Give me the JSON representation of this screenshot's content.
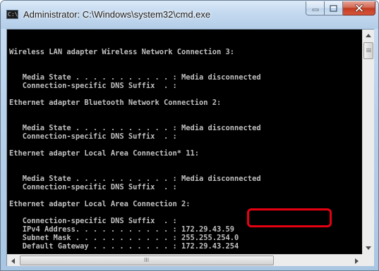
{
  "window": {
    "title": "Administrator: C:\\Windows\\system32\\cmd.exe",
    "app_icon_text": "C:\\"
  },
  "caption_buttons": {
    "minimize_icon": "minimize-icon",
    "maximize_icon": "maximize-icon",
    "close_icon": "close-icon"
  },
  "console": {
    "lines": [
      "",
      "Wireless LAN adapter Wireless Network Connection 3:",
      "",
      "   Media State . . . . . . . . . . . : Media disconnected",
      "   Connection-specific DNS Suffix  . :",
      "",
      "Ethernet adapter Bluetooth Network Connection 2:",
      "",
      "   Media State . . . . . . . . . . . : Media disconnected",
      "   Connection-specific DNS Suffix  . :",
      "",
      "Ethernet adapter Local Area Connection* 11:",
      "",
      "   Media State . . . . . . . . . . . : Media disconnected",
      "   Connection-specific DNS Suffix  . :",
      "",
      "Ethernet adapter Local Area Connection 2:",
      "",
      "   Connection-specific DNS Suffix  . :",
      "   IPv4 Address. . . . . . . . . . . : 172.29.43.59",
      "   Subnet Mask . . . . . . . . . . . : 255.255.254.0",
      "   Default Gateway . . . . . . . . . : 172.29.43.254"
    ],
    "text_color": "#c0c0c0",
    "background": "#000000",
    "highlight_color": "#e60012"
  },
  "scrollbars": {
    "up_icon": "arrow-up-icon",
    "down_icon": "arrow-down-icon",
    "left_icon": "arrow-left-icon",
    "right_icon": "arrow-right-icon",
    "h_thumb_grip": "III"
  }
}
